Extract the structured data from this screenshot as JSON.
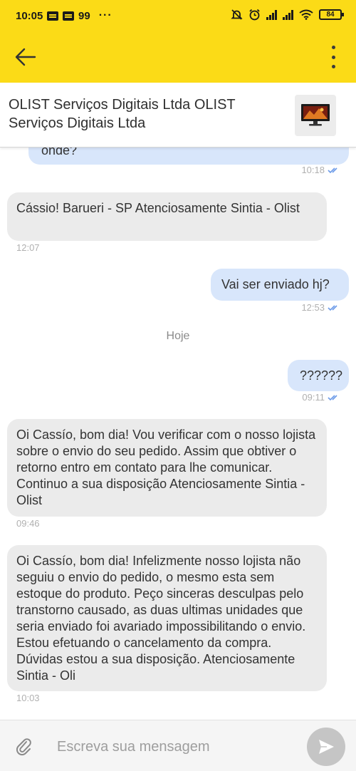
{
  "status_bar": {
    "time": "10:05",
    "notification_count": "99",
    "more_dots": "···",
    "battery": "84"
  },
  "app_bar": {
    "back_icon": "arrow-left-icon",
    "menu_icon": "more-vertical-icon"
  },
  "chat": {
    "title": "OLIST Serviços Digitais Ltda OLIST Serviços Digitais Ltda",
    "thumbnail_icon": "monitor-icon"
  },
  "messages": [
    {
      "direction": "out",
      "text": "onde?",
      "time": "10:18",
      "read": true
    },
    {
      "direction": "in",
      "text": "Cássio! Barueri - SP Atenciosamente Sintia - Olist",
      "time": "12:07"
    },
    {
      "direction": "out",
      "text": "Vai ser enviado hj?",
      "time": "12:53",
      "read": true
    },
    {
      "direction": "separator",
      "text": "Hoje"
    },
    {
      "direction": "out",
      "text": "??????",
      "time": "09:11",
      "read": true
    },
    {
      "direction": "in",
      "text": "Oi Cassío, bom dia! Vou verificar com o nosso lojista sobre o envio do seu pedido. Assim que obtiver o retorno entro em contato para lhe comunicar. Continuo a sua disposição Atenciosamente Sintia - Olist",
      "time": "09:46"
    },
    {
      "direction": "in",
      "text": "Oi Cassío, bom dia! Infelizmente nosso lojista não seguiu o envio do pedido, o mesmo esta sem estoque do produto. Peço sinceras desculpas pelo transtorno causado, as duas ultimas unidades que seria enviado foi avariado impossibilitando o envio. Estou efetuando o cancelamento da compra. Dúvidas estou a sua disposição. Atenciosamente Sintia - Oli",
      "time": "10:03"
    }
  ],
  "composer": {
    "placeholder": "Escreva sua mensagem",
    "attach_icon": "paperclip-icon",
    "send_icon": "send-icon"
  },
  "colors": {
    "brand_yellow": "#fbdb17",
    "outgoing_bubble": "#d8e6fb",
    "incoming_bubble": "#ebebeb",
    "read_check": "#6c9be8"
  }
}
